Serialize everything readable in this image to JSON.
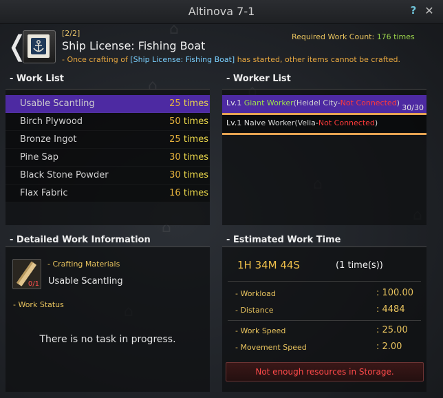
{
  "window": {
    "title": "Altinova 7-1",
    "help_icon": "question-mark-icon",
    "close_icon": "close-icon"
  },
  "header": {
    "back_icon": "chevron-left-icon",
    "progress": "[2/2]",
    "item_name": "Ship License: Fishing Boat",
    "required_label": "Required Work Count: ",
    "required_value": "176 times",
    "notice_prefix": "- Once crafting of ",
    "notice_item": "[Ship License: Fishing Boat]",
    "notice_suffix": " has started, other items cannot be crafted."
  },
  "work_list": {
    "label": "- Work List",
    "items": [
      {
        "name": "Usable Scantling",
        "count": "25",
        "unit": "times",
        "selected": true
      },
      {
        "name": "Birch Plywood",
        "count": "50",
        "unit": "times",
        "selected": false
      },
      {
        "name": "Bronze Ingot",
        "count": "25",
        "unit": "times",
        "selected": false
      },
      {
        "name": "Pine Sap",
        "count": "30",
        "unit": "times",
        "selected": false
      },
      {
        "name": "Black Stone Powder",
        "count": "30",
        "unit": "times",
        "selected": false
      },
      {
        "name": "Flax Fabric",
        "count": "16",
        "unit": "times",
        "selected": false
      }
    ]
  },
  "worker_list": {
    "label": "- Worker List",
    "workers": [
      {
        "level": "Lv.1",
        "name": "Giant Worker",
        "town": "(Heidel City-",
        "status": "Not Connected",
        "close": ")",
        "stamina": "30/30"
      },
      {
        "level": "Lv.1",
        "name": "Naive Worker",
        "town": "(Velia-",
        "status": "Not Connected",
        "close": ")"
      }
    ]
  },
  "detail": {
    "label": "- Detailed Work Information",
    "crafting_materials_label": "- Crafting Materials",
    "material_name": "Usable Scantling",
    "material_count": "0/1",
    "work_status_label": "- Work Status",
    "no_task": "There is no task in progress."
  },
  "estimate": {
    "label": "- Estimated Work Time",
    "time": "1H 34M 44S",
    "times": "(1 time(s))",
    "stats": [
      {
        "label": "- Workload",
        "value": ": 100.00"
      },
      {
        "label": "- Distance",
        "value": ": 4484"
      },
      {
        "label": "- Work Speed",
        "value": ": 25.00"
      },
      {
        "label": "- Movement Speed",
        "value": ": 2.00"
      }
    ],
    "warning": "Not enough resources in Storage."
  },
  "colors": {
    "selected_row": "#4d2aa2",
    "accent_gold": "#e8c35e",
    "warning_red": "#ff4a4a",
    "highlight_green": "#9de04a"
  }
}
